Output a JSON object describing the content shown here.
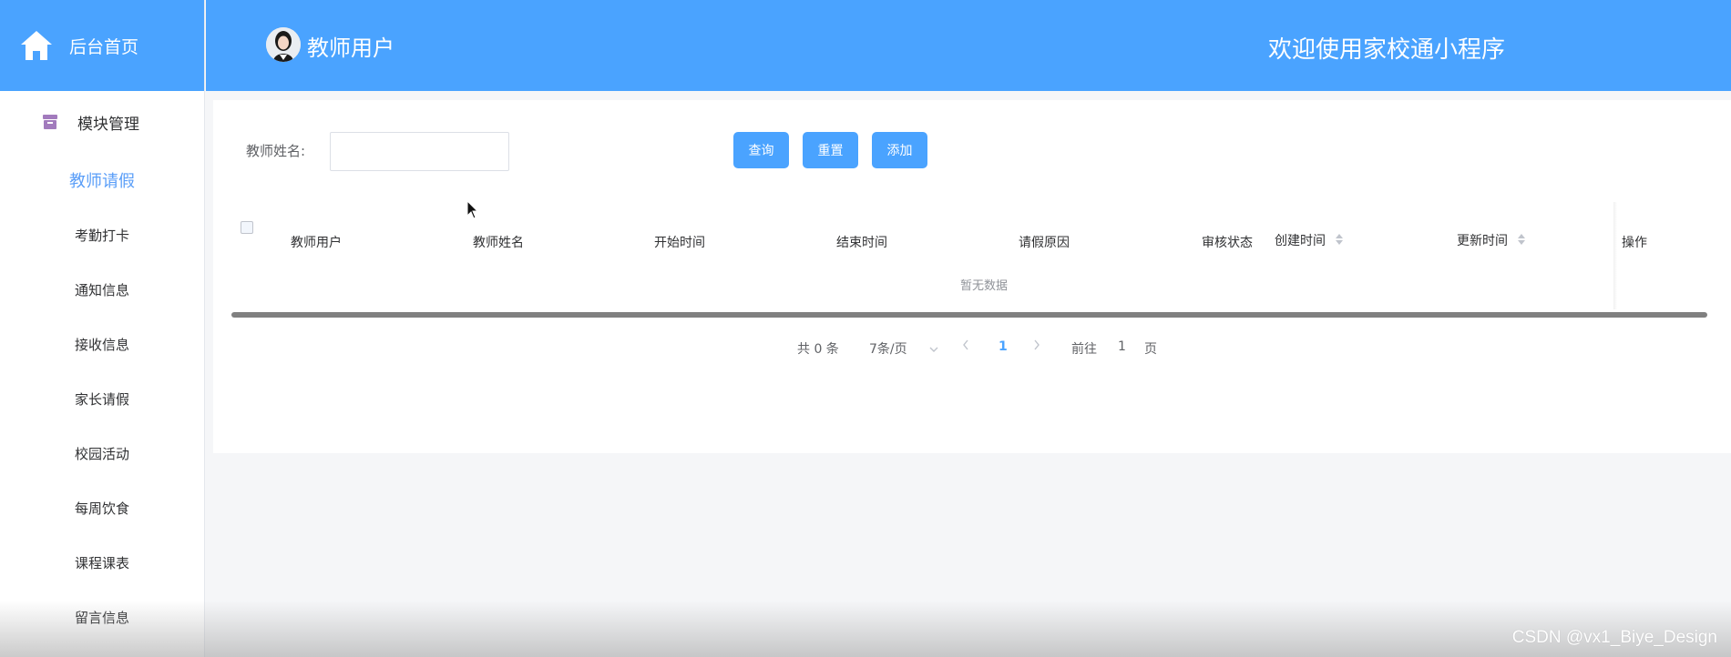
{
  "sidebar": {
    "home_label": "后台首页",
    "group_label": "模块管理",
    "items": [
      {
        "label": "教师请假"
      },
      {
        "label": "考勤打卡"
      },
      {
        "label": "通知信息"
      },
      {
        "label": "接收信息"
      },
      {
        "label": "家长请假"
      },
      {
        "label": "校园活动"
      },
      {
        "label": "每周饮食"
      },
      {
        "label": "课程课表"
      },
      {
        "label": "留言信息"
      }
    ],
    "active_index": 0
  },
  "header": {
    "user_role": "教师用户",
    "welcome": "欢迎使用家校通小程序"
  },
  "search": {
    "label": "教师姓名:",
    "value": "",
    "placeholder": ""
  },
  "buttons": {
    "query": "查询",
    "reset": "重置",
    "add": "添加"
  },
  "table": {
    "columns": [
      "教师用户",
      "教师姓名",
      "开始时间",
      "结束时间",
      "请假原因",
      "审核状态",
      "创建时间",
      "更新时间",
      "操作"
    ],
    "rows": [],
    "empty_text": "暂无数据"
  },
  "pagination": {
    "total_text": "共 0 条",
    "page_size_text": "7条/页",
    "current_page": "1",
    "goto_label": "前往",
    "goto_value": "1",
    "page_unit": "页"
  },
  "watermark": "CSDN @vx1_Biye_Design",
  "colors": {
    "primary": "#4aa3ff",
    "active_text": "#5a9ef8"
  }
}
